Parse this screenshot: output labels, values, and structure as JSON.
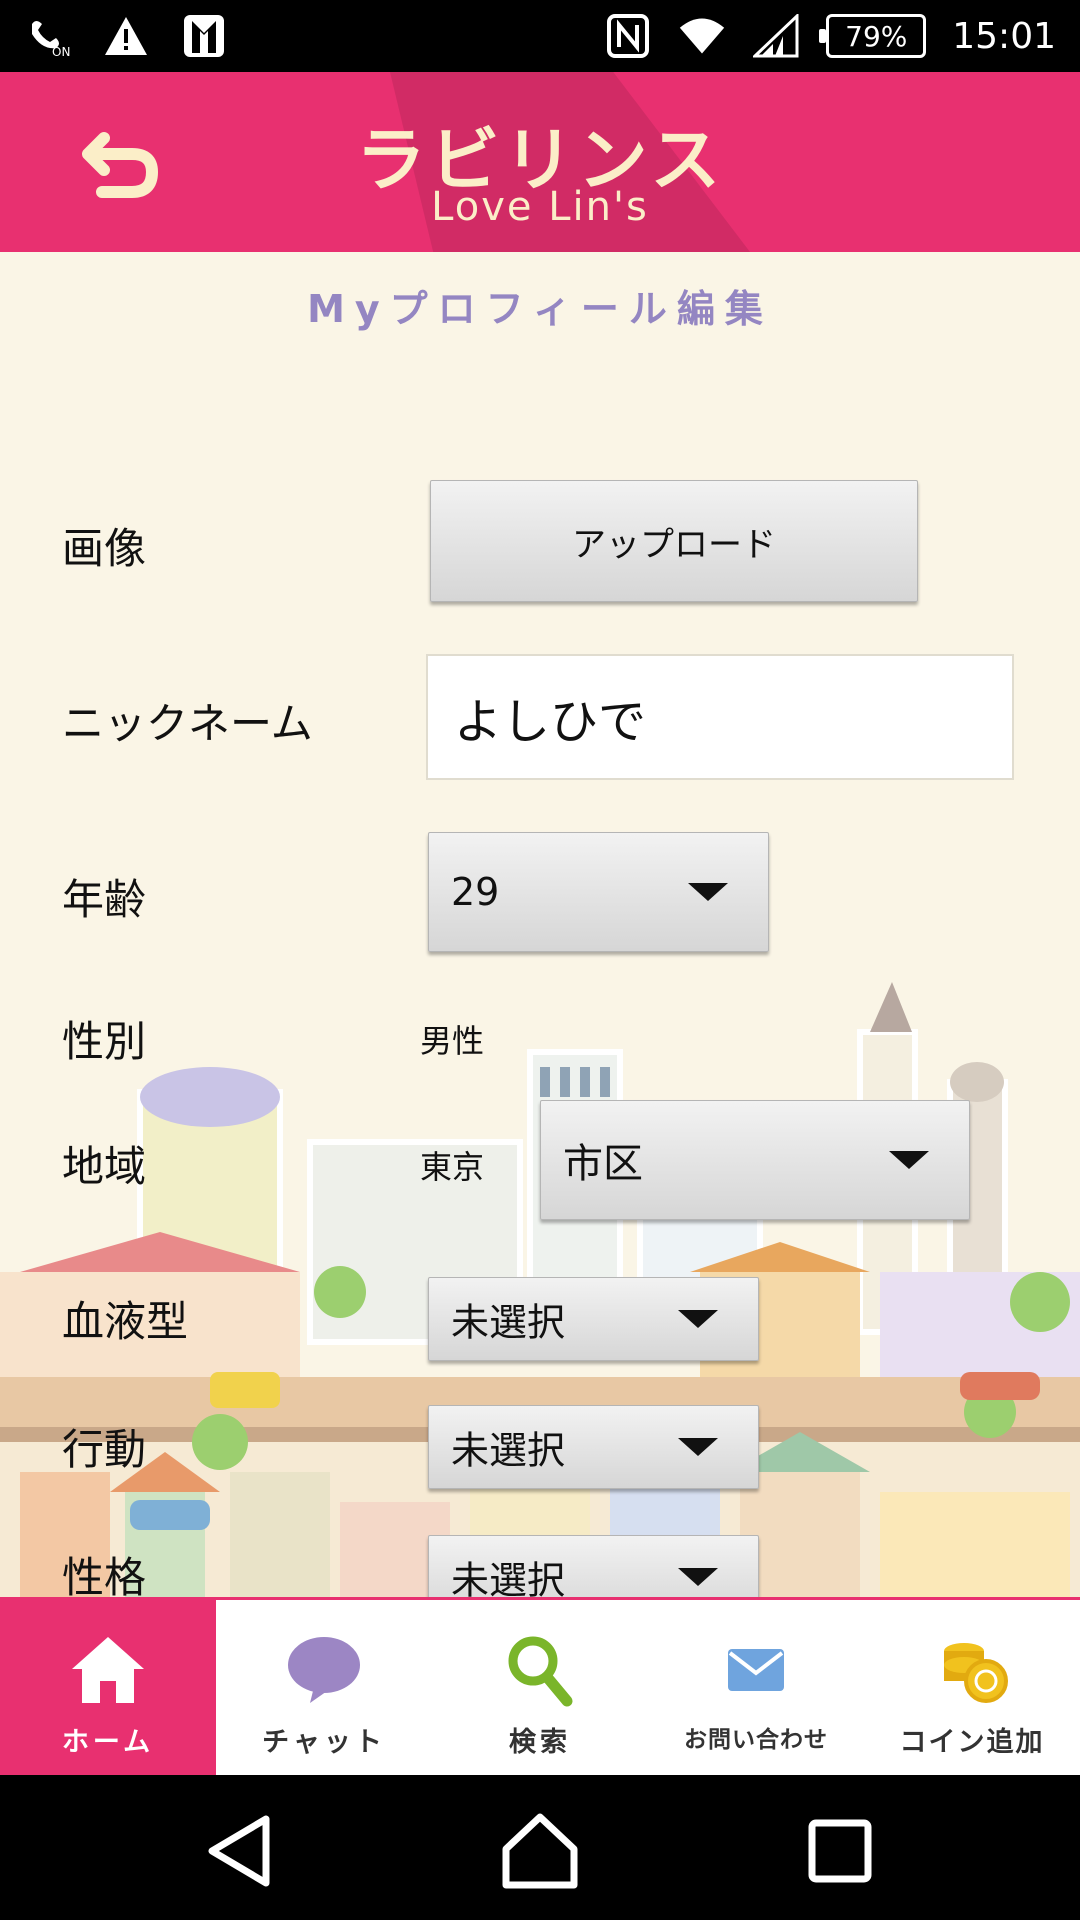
{
  "status_bar": {
    "battery": "79%",
    "time": "15:01",
    "icons": [
      "nfc-on-icon",
      "warning-icon",
      "tuxedo-icon",
      "nfc-icon",
      "wifi-icon",
      "signal-icon"
    ]
  },
  "header": {
    "logo_jp": "ラビリンス",
    "logo_en": "Love Lin's",
    "back_icon": "back-arrow-icon"
  },
  "page": {
    "title": "Myプロフィール編集"
  },
  "form": {
    "image": {
      "label": "画像",
      "button": "アップロード"
    },
    "nickname": {
      "label": "ニックネーム",
      "value": "よしひで"
    },
    "age": {
      "label": "年齢",
      "value": "29"
    },
    "gender": {
      "label": "性別",
      "value": "男性"
    },
    "region": {
      "label": "地域",
      "prefecture": "東京",
      "city": "市区"
    },
    "blood": {
      "label": "血液型",
      "value": "未選択"
    },
    "behavior": {
      "label": "行動",
      "value": "未選択"
    },
    "personality": {
      "label": "性格",
      "value": "未選択"
    }
  },
  "bottom_nav": [
    {
      "label": "ホーム",
      "icon": "home-icon",
      "active": true
    },
    {
      "label": "チャット",
      "icon": "chat-bubble-icon",
      "active": false
    },
    {
      "label": "検索",
      "icon": "search-icon",
      "active": false
    },
    {
      "label": "お問い合わせ",
      "icon": "mail-icon",
      "active": false
    },
    {
      "label": "コイン追加",
      "icon": "coins-icon",
      "active": false
    }
  ],
  "colors": {
    "brand_pink": "#e83070",
    "cream": "#faf5e6",
    "title_purple": "#9486c2"
  }
}
